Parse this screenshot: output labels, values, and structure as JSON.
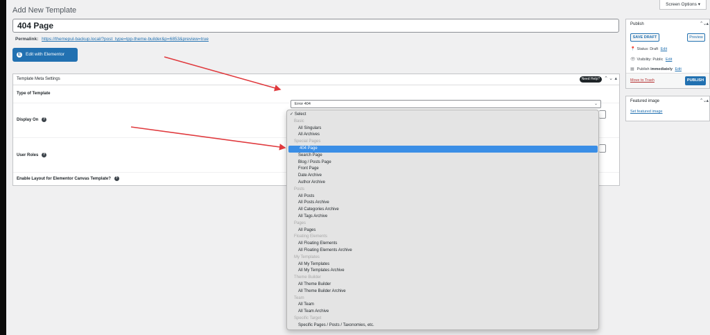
{
  "header": {
    "screen_options": "Screen Options ▾",
    "page_heading": "Add New Template"
  },
  "editor": {
    "title_value": "404 Page",
    "permalink_label": "Permalink:",
    "permalink_url": "https://themepul-backup.local/?post_type=tpp-theme-builder&p=6853&preview=true",
    "edit_elementor_label": "Edit with Elementor",
    "elementor_icon_glyph": "E"
  },
  "meta_box": {
    "title": "Template Meta Settings",
    "need_help": "Need Help?",
    "rows": {
      "type_of_template": {
        "label": "Type of Template",
        "value": "Error 404"
      },
      "display_on": {
        "label": "Display On"
      },
      "user_roles": {
        "label": "User Roles"
      },
      "canvas": {
        "label": "Enable Layout for Elementor Canvas Template?"
      }
    }
  },
  "dropdown": {
    "selected": "404 Page",
    "items": [
      {
        "type": "first",
        "label": "✓ Select"
      },
      {
        "type": "group",
        "label": "Basic"
      },
      {
        "type": "opt",
        "label": "All Singulars"
      },
      {
        "type": "opt",
        "label": "All Archives"
      },
      {
        "type": "group",
        "label": "Special Pages"
      },
      {
        "type": "opt",
        "label": "404 Page"
      },
      {
        "type": "opt",
        "label": "Search Page"
      },
      {
        "type": "opt",
        "label": "Blog / Posts Page"
      },
      {
        "type": "opt",
        "label": "Front Page"
      },
      {
        "type": "opt",
        "label": "Date Archive"
      },
      {
        "type": "opt",
        "label": "Author Archive"
      },
      {
        "type": "group",
        "label": "Posts"
      },
      {
        "type": "opt",
        "label": "All Posts"
      },
      {
        "type": "opt",
        "label": "All Posts Archive"
      },
      {
        "type": "opt",
        "label": "All Categories Archive"
      },
      {
        "type": "opt",
        "label": "All Tags Archive"
      },
      {
        "type": "group",
        "label": "Pages"
      },
      {
        "type": "opt",
        "label": "All Pages"
      },
      {
        "type": "group",
        "label": "Floating Elements"
      },
      {
        "type": "opt",
        "label": "All Floating Elements"
      },
      {
        "type": "opt",
        "label": "All Floating Elements Archive"
      },
      {
        "type": "group",
        "label": "My Templates"
      },
      {
        "type": "opt",
        "label": "All My Templates"
      },
      {
        "type": "opt",
        "label": "All My Templates Archive"
      },
      {
        "type": "group",
        "label": "Theme Builder"
      },
      {
        "type": "opt",
        "label": "All Theme Builder"
      },
      {
        "type": "opt",
        "label": "All Theme Builder Archive"
      },
      {
        "type": "group",
        "label": "Team"
      },
      {
        "type": "opt",
        "label": "All Team"
      },
      {
        "type": "opt",
        "label": "All Team Archive"
      },
      {
        "type": "group",
        "label": "Specific Target"
      },
      {
        "type": "opt",
        "label": "Specific Pages / Posts / Taxonomies, etc."
      }
    ]
  },
  "publish": {
    "title": "Publish",
    "save_draft": "SAVE DRAFT",
    "preview": "Preview",
    "status_label": "Status:",
    "status_value": "Draft",
    "visibility_label": "Visibility:",
    "visibility_value": "Public",
    "publish_label": "Publish",
    "publish_value": "immediately",
    "edit_link": "Edit",
    "move_to_trash": "Move to Trash",
    "publish_button": "PUBLISH"
  },
  "featured": {
    "title": "Featured image",
    "set_link": "Set featured image"
  },
  "colors": {
    "accent": "#2271b1",
    "annotation_arrow": "#e03a3e",
    "dropdown_highlight": "#3a8ee6"
  },
  "icons": [
    "elementor-icon",
    "help-icon",
    "chevron-down-icon",
    "pin-icon",
    "eye-icon",
    "calendar-icon",
    "arrow-icon"
  ]
}
